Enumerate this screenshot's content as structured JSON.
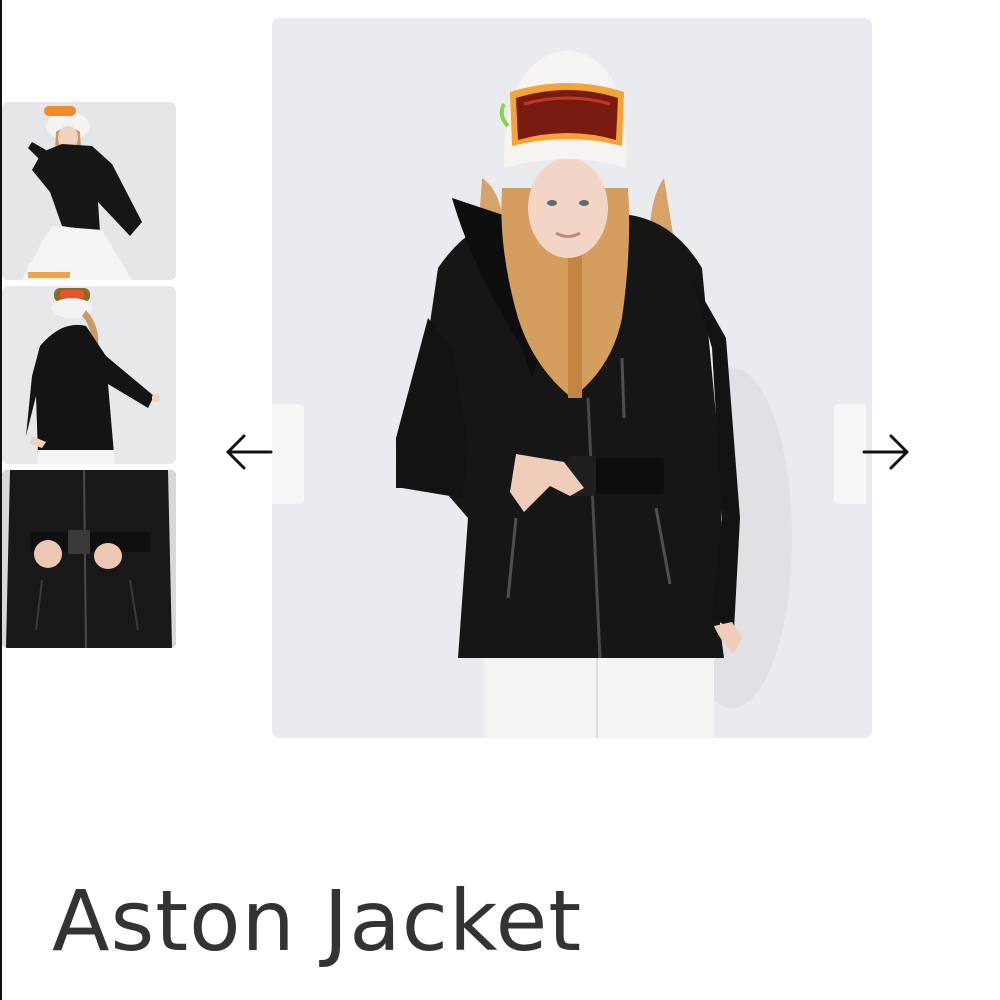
{
  "product": {
    "title": "Aston Jacket"
  },
  "gallery": {
    "thumbnails": [
      {
        "alt": "jacket-front-view-thumbnail"
      },
      {
        "alt": "jacket-back-view-thumbnail"
      },
      {
        "alt": "jacket-belt-detail-thumbnail"
      }
    ],
    "prev_icon": "arrow-left-icon",
    "next_icon": "arrow-right-icon"
  },
  "colors": {
    "text": "#333333",
    "photo_background": "#e9ebee",
    "jacket": "#151515"
  }
}
